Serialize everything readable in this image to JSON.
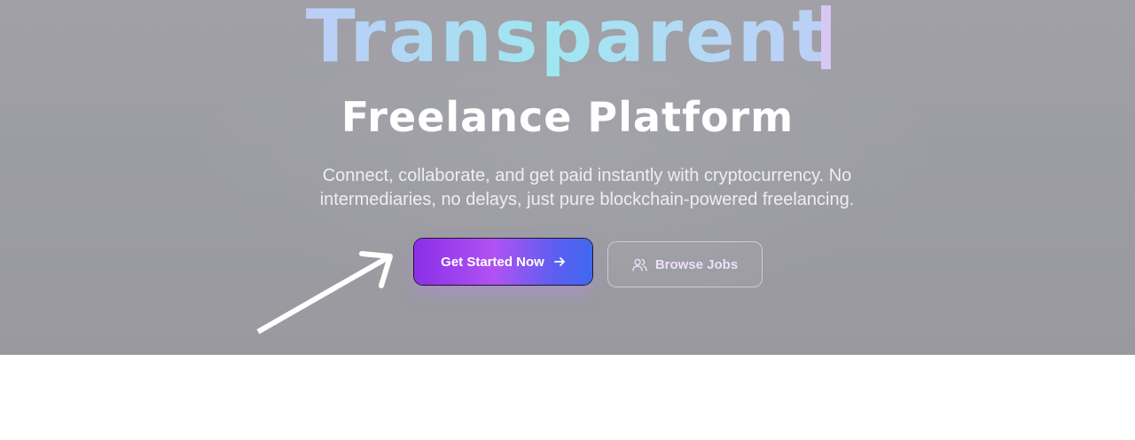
{
  "hero": {
    "title": "Transparent",
    "subtitle": "Freelance Platform",
    "description_line1": "Connect, collaborate, and get paid instantly with cryptocurrency. No",
    "description_line2": "intermediaries, no delays, just pure blockchain-powered freelancing."
  },
  "actions": {
    "primary_label": "Get Started Now",
    "primary_icon": "arrow-right-icon",
    "secondary_label": "Browse Jobs",
    "secondary_icon": "users-icon"
  },
  "colors": {
    "primary_gradient_start": "#8b2fe8",
    "primary_gradient_end": "#3f68ef",
    "title_gradient_mid": "#9fe7f1",
    "annotation_arrow": "#ffffff"
  }
}
